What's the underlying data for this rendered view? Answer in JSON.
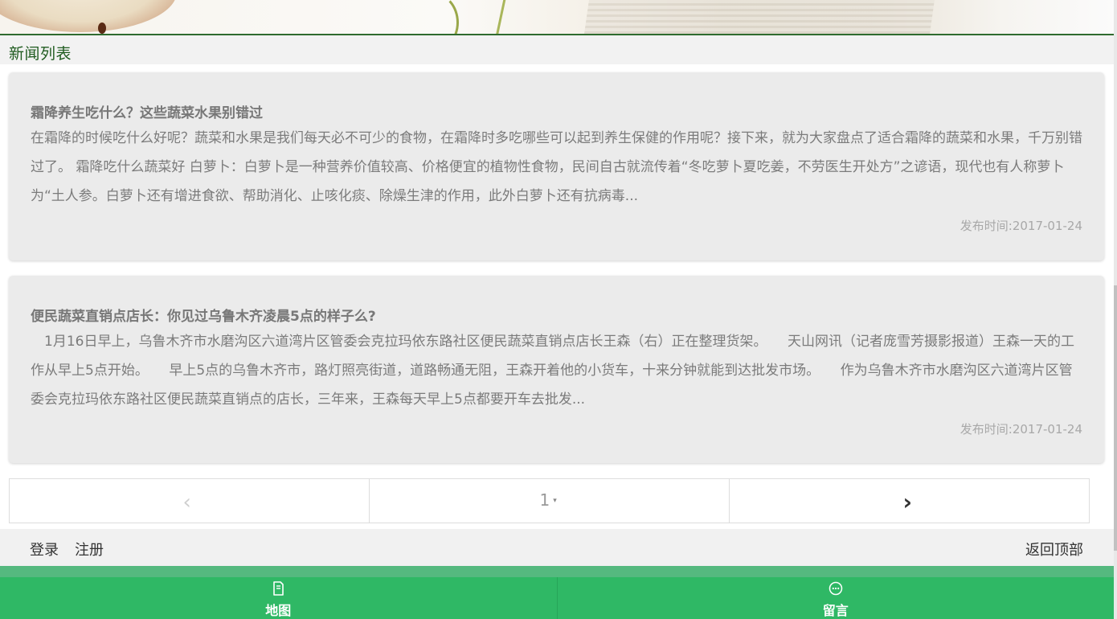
{
  "section": {
    "title": "新闻列表"
  },
  "articles": [
    {
      "title": "霜降养生吃什么？这些蔬菜水果别错过",
      "excerpt": "在霜降的时候吃什么好呢？蔬菜和水果是我们每天必不可少的食物，在霜降时多吃哪些可以起到养生保健的作用呢？接下来，就为大家盘点了适合霜降的蔬菜和水果，千万别错过了。 霜降吃什么蔬菜好 白萝卜：白萝卜是一种营养价值较高、价格便宜的植物性食物，民间自古就流传着“冬吃萝卜夏吃姜，不劳医生开处方”之谚语，现代也有人称萝卜为“土人参。白萝卜还有增进食欲、帮助消化、止咳化痰、除燥生津的作用，此外白萝卜还有抗病毒...",
      "date": "发布时间:2017-01-24"
    },
    {
      "title": "便民蔬菜直销点店长：你见过乌鲁木齐凌晨5点的样子么?",
      "excerpt": "　1月16日早上，乌鲁木齐市水磨沟区六道湾片区管委会克拉玛依东路社区便民蔬菜直销点店长王森（右）正在整理货架。　　天山网讯（记者庞雪芳摄影报道）王森一天的工作从早上5点开始。　　早上5点的乌鲁木齐市，路灯照亮街道，道路畅通无阻，王森开着他的小货车，十来分钟就能到达批发市场。　　作为乌鲁木齐市水磨沟区六道湾片区管委会克拉玛依东路社区便民蔬菜直销点的店长，三年来，王森每天早上5点都要开车去批发...",
      "date": "发布时间:2017-01-24"
    }
  ],
  "pager": {
    "prev": "‹",
    "current": "1",
    "caret": "▾",
    "next": "›"
  },
  "footer": {
    "login": "登录",
    "register": "注册",
    "back_to_top": "返回顶部"
  },
  "tabs": [
    {
      "label": "地图",
      "icon": "map-icon"
    },
    {
      "label": "留言",
      "icon": "message-icon"
    }
  ],
  "colors": {
    "accent_green": "#2fb865",
    "section_title": "#1f5b1f"
  }
}
